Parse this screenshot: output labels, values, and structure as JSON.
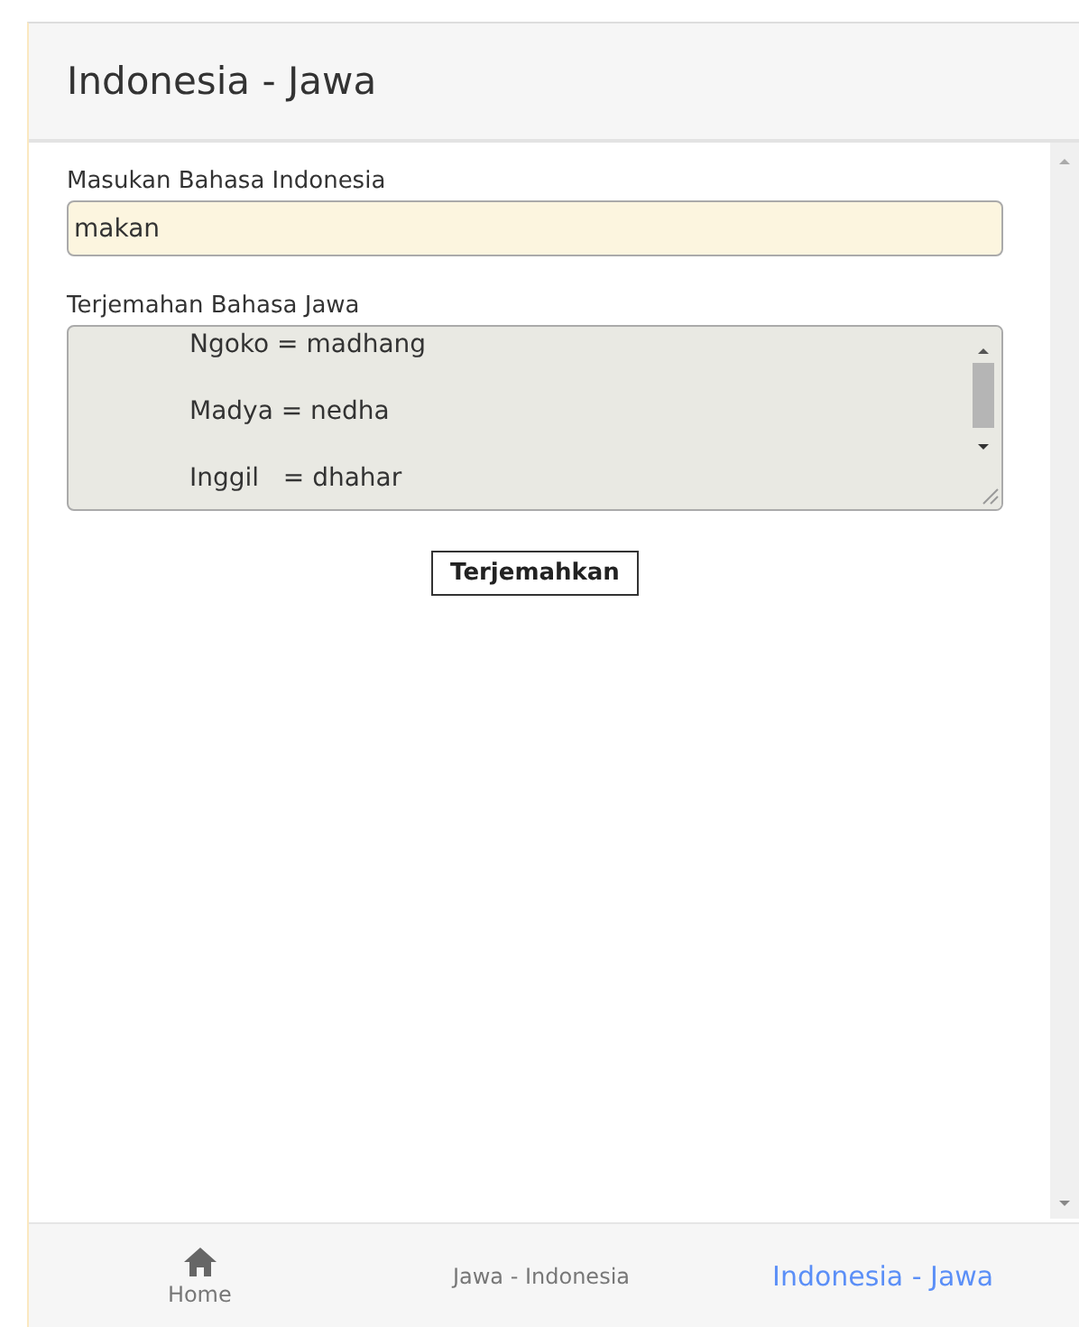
{
  "header": {
    "title": "Indonesia - Jawa"
  },
  "input": {
    "label": "Masukan Bahasa Indonesia",
    "value": "makan"
  },
  "output": {
    "label": "Terjemahan Bahasa Jawa",
    "lines": [
      "Ngoko = madhang",
      "Madya = nedha",
      "Inggil   = dhahar"
    ]
  },
  "button": {
    "label": "Terjemahkan"
  },
  "tabs": [
    {
      "kind": "icon",
      "label": "Home",
      "selected": false
    },
    {
      "kind": "text",
      "label": "Jawa - Indonesia",
      "selected": false
    },
    {
      "kind": "text",
      "label": "Indonesia - Jawa",
      "selected": true
    }
  ]
}
